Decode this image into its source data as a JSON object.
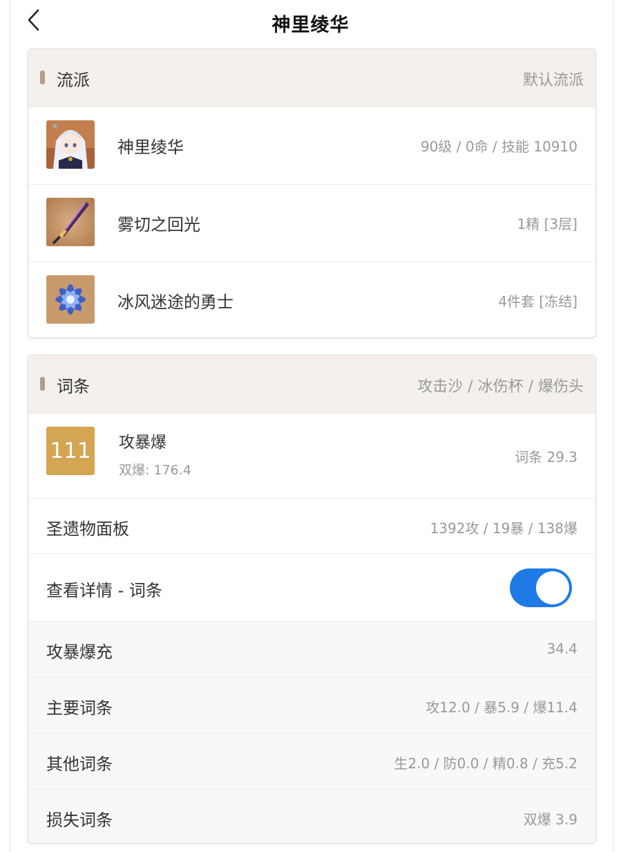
{
  "header": {
    "title": "神里绫华"
  },
  "build_card": {
    "title": "流派",
    "right": "默认流派",
    "items": [
      {
        "name": "神里绫华",
        "detail": "90级 / 0命 / 技能 10910",
        "icon": "character-portrait"
      },
      {
        "name": "雾切之回光",
        "detail": "1精 [3层]",
        "icon": "sword-weapon-icon"
      },
      {
        "name": "冰风迷途的勇士",
        "detail": "4件套 [冻结]",
        "icon": "artifact-flower-icon"
      }
    ]
  },
  "stats_card": {
    "title": "词条",
    "right": "攻击沙 / 冰伤杯 / 爆伤头",
    "score": {
      "badge": "111",
      "name": "攻暴爆",
      "sub": "双爆: 176.4",
      "value": "词条 29.3"
    },
    "panel": {
      "label": "圣遗物面板",
      "value": "1392攻 / 19暴 / 138爆"
    },
    "toggle": {
      "label": "查看详情 - 词条",
      "on": true
    },
    "details": [
      {
        "label": "攻暴爆充",
        "value": "34.4"
      },
      {
        "label": "主要词条",
        "value": "攻12.0 / 暴5.9 / 爆11.4"
      },
      {
        "label": "其他词条",
        "value": "生2.0 / 防0.0 / 精0.8 / 充5.2"
      },
      {
        "label": "损失词条",
        "value": "双爆 3.9"
      }
    ]
  },
  "colors": {
    "accent_toggle": "#1e7be6",
    "badge": "#d4a552",
    "header_bg": "#f4f1ec",
    "header_bar": "#b49b8c"
  }
}
